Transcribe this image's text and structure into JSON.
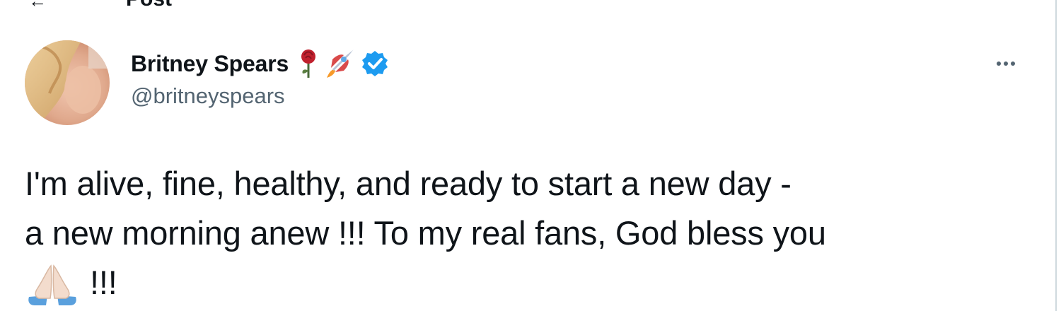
{
  "header": {
    "back_icon": "arrow-left-icon",
    "title_fragment": "Post"
  },
  "tweet": {
    "author": {
      "display_name": "Britney Spears",
      "handle": "@britneyspears",
      "badges": [
        "rose-emoji-icon",
        "rocket-emoji-icon",
        "verified-badge-icon"
      ],
      "verified_color": "#1d9bf0"
    },
    "more_icon": "more-options-icon",
    "text_lines": [
      "I'm alive, fine, healthy, and ready to start a new day -",
      "a new morning anew !!! To my real fans, God bless you",
      "!!!"
    ],
    "trailing_emoji": "folded-hands-emoji-icon"
  },
  "colors": {
    "text_primary": "#0f1419",
    "text_secondary": "#536471",
    "accent": "#1d9bf0"
  }
}
